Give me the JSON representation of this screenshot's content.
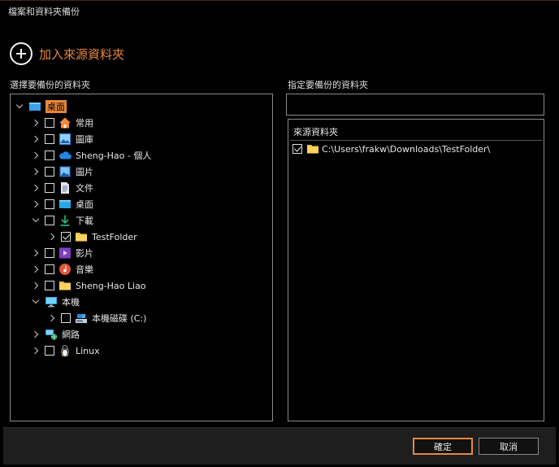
{
  "window": {
    "title": "檔案和資料夾備份"
  },
  "add_source": {
    "label": "加入來源資料夾"
  },
  "left_section": {
    "label": "選擇要備份的資料夾"
  },
  "right_section": {
    "label": "指定要備份的資料夾",
    "destination_value": ""
  },
  "tree": [
    {
      "label": "桌面",
      "icon": "desktop-folder-icon",
      "indent": 0,
      "expander": "down",
      "checkbox": "none",
      "selected": true
    },
    {
      "label": "常用",
      "icon": "home-icon",
      "indent": 1,
      "expander": "right",
      "checkbox": "unchecked"
    },
    {
      "label": "圖庫",
      "icon": "gallery-icon",
      "indent": 1,
      "expander": "right",
      "checkbox": "unchecked"
    },
    {
      "label": "Sheng-Hao - 個人",
      "icon": "onedrive-cloud-icon",
      "indent": 1,
      "expander": "right",
      "checkbox": "unchecked"
    },
    {
      "label": "圖片",
      "icon": "pictures-icon",
      "indent": 1,
      "expander": "right",
      "checkbox": "unchecked"
    },
    {
      "label": "文件",
      "icon": "documents-icon",
      "indent": 1,
      "expander": "right",
      "checkbox": "unchecked"
    },
    {
      "label": "桌面",
      "icon": "desktop-icon",
      "indent": 1,
      "expander": "right",
      "checkbox": "unchecked"
    },
    {
      "label": "下載",
      "icon": "download-arrow-icon",
      "indent": 1,
      "expander": "down",
      "checkbox": "unchecked"
    },
    {
      "label": "TestFolder",
      "icon": "folder-icon",
      "indent": 2,
      "expander": "right",
      "checkbox": "checked"
    },
    {
      "label": "影片",
      "icon": "videos-icon",
      "indent": 1,
      "expander": "right",
      "checkbox": "unchecked"
    },
    {
      "label": "音樂",
      "icon": "music-icon",
      "indent": 1,
      "expander": "right",
      "checkbox": "unchecked"
    },
    {
      "label": "Sheng-Hao Liao",
      "icon": "folder-icon",
      "indent": 1,
      "expander": "right",
      "checkbox": "unchecked"
    },
    {
      "label": "本機",
      "icon": "computer-icon",
      "indent": 1,
      "expander": "down",
      "checkbox": "none"
    },
    {
      "label": "本機磁碟 (C:)",
      "icon": "drive-icon",
      "indent": 2,
      "expander": "right",
      "checkbox": "unchecked"
    },
    {
      "label": "網路",
      "icon": "network-icon",
      "indent": 1,
      "expander": "right",
      "checkbox": "none"
    },
    {
      "label": "Linux",
      "icon": "linux-penguin-icon",
      "indent": 1,
      "expander": "right",
      "checkbox": "unchecked"
    }
  ],
  "source_list": {
    "header": "來源資料夾",
    "items": [
      {
        "path": "C:\\Users\\frakw\\Downloads\\TestFolder\\",
        "checked": true,
        "icon": "folder-icon"
      }
    ]
  },
  "footer": {
    "ok_label": "確定",
    "cancel_label": "取消"
  },
  "colors": {
    "accent": "#e8883a",
    "background": "#000000",
    "panel_border": "#8a8a8a",
    "footer": "#1e1e1e"
  }
}
